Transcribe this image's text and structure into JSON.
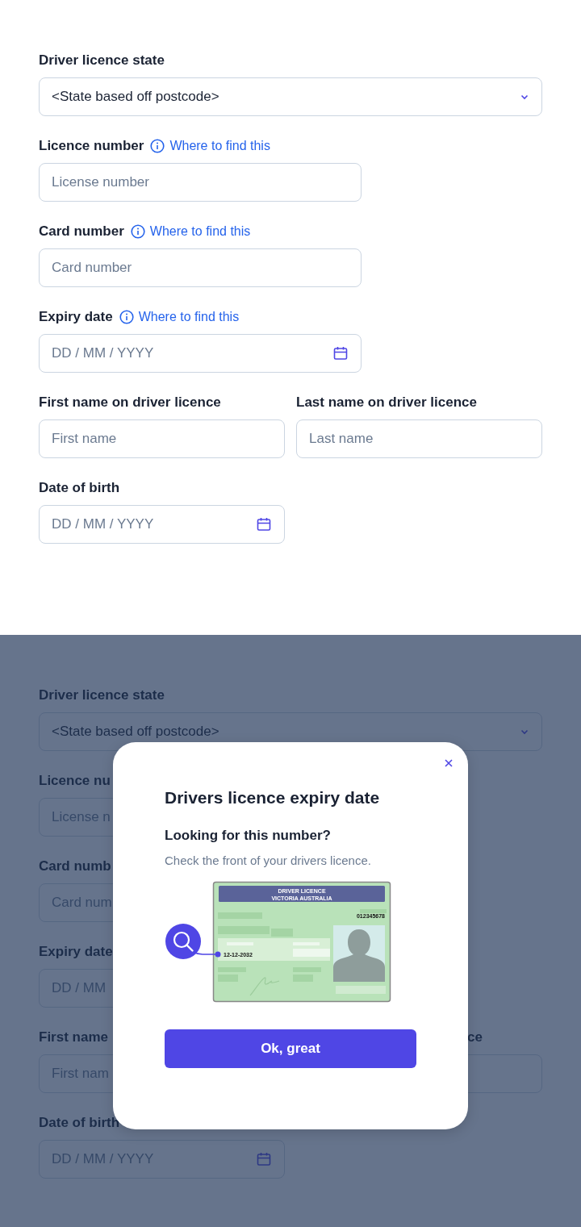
{
  "form": {
    "fields": [
      {
        "kind": "select",
        "label": "Driver licence state",
        "value": "<State based off postcode>"
      },
      {
        "kind": "text",
        "label": "Licence number",
        "help_link": "Where to find this",
        "placeholder": "License number"
      },
      {
        "kind": "text",
        "label": "Card number",
        "help_link": "Where to find this",
        "placeholder": "Card number"
      },
      {
        "kind": "date",
        "label": "Expiry date",
        "help_link": "Where to find this",
        "placeholder": "DD / MM / YYYY"
      },
      {
        "kind": "text",
        "label": "First name on driver licence",
        "placeholder": "First name"
      },
      {
        "kind": "text",
        "label": "Last name on driver licence",
        "placeholder": "Last name"
      },
      {
        "kind": "date",
        "label": "Date of birth",
        "placeholder": "DD / MM / YYYY"
      }
    ]
  },
  "background_form": {
    "fields": [
      {
        "kind": "select",
        "label": "Driver licence state",
        "value": "<State based off postcode>"
      },
      {
        "kind": "text",
        "label": "Licence nu",
        "placeholder": "License n"
      },
      {
        "kind": "text",
        "label": "Card numb",
        "placeholder": "Card num"
      },
      {
        "kind": "text",
        "label": "Expiry date",
        "placeholder": "DD / MM"
      },
      {
        "kind": "text",
        "label": "First name",
        "placeholder": "First nam"
      },
      {
        "kind": "text",
        "label": "ce"
      },
      {
        "kind": "date",
        "label": "Date of birth",
        "placeholder": "DD / MM / YYYY"
      }
    ]
  },
  "modal": {
    "title": "Drivers licence expiry date",
    "subtitle": "Looking for this number?",
    "body": "Check the front of your drivers licence.",
    "card": {
      "heading": [
        "DRIVER LICENCE",
        "VICTORIA AUSTRALIA"
      ],
      "number": "012345678",
      "expiry": "12-12-2032"
    },
    "button": "Ok, great"
  }
}
